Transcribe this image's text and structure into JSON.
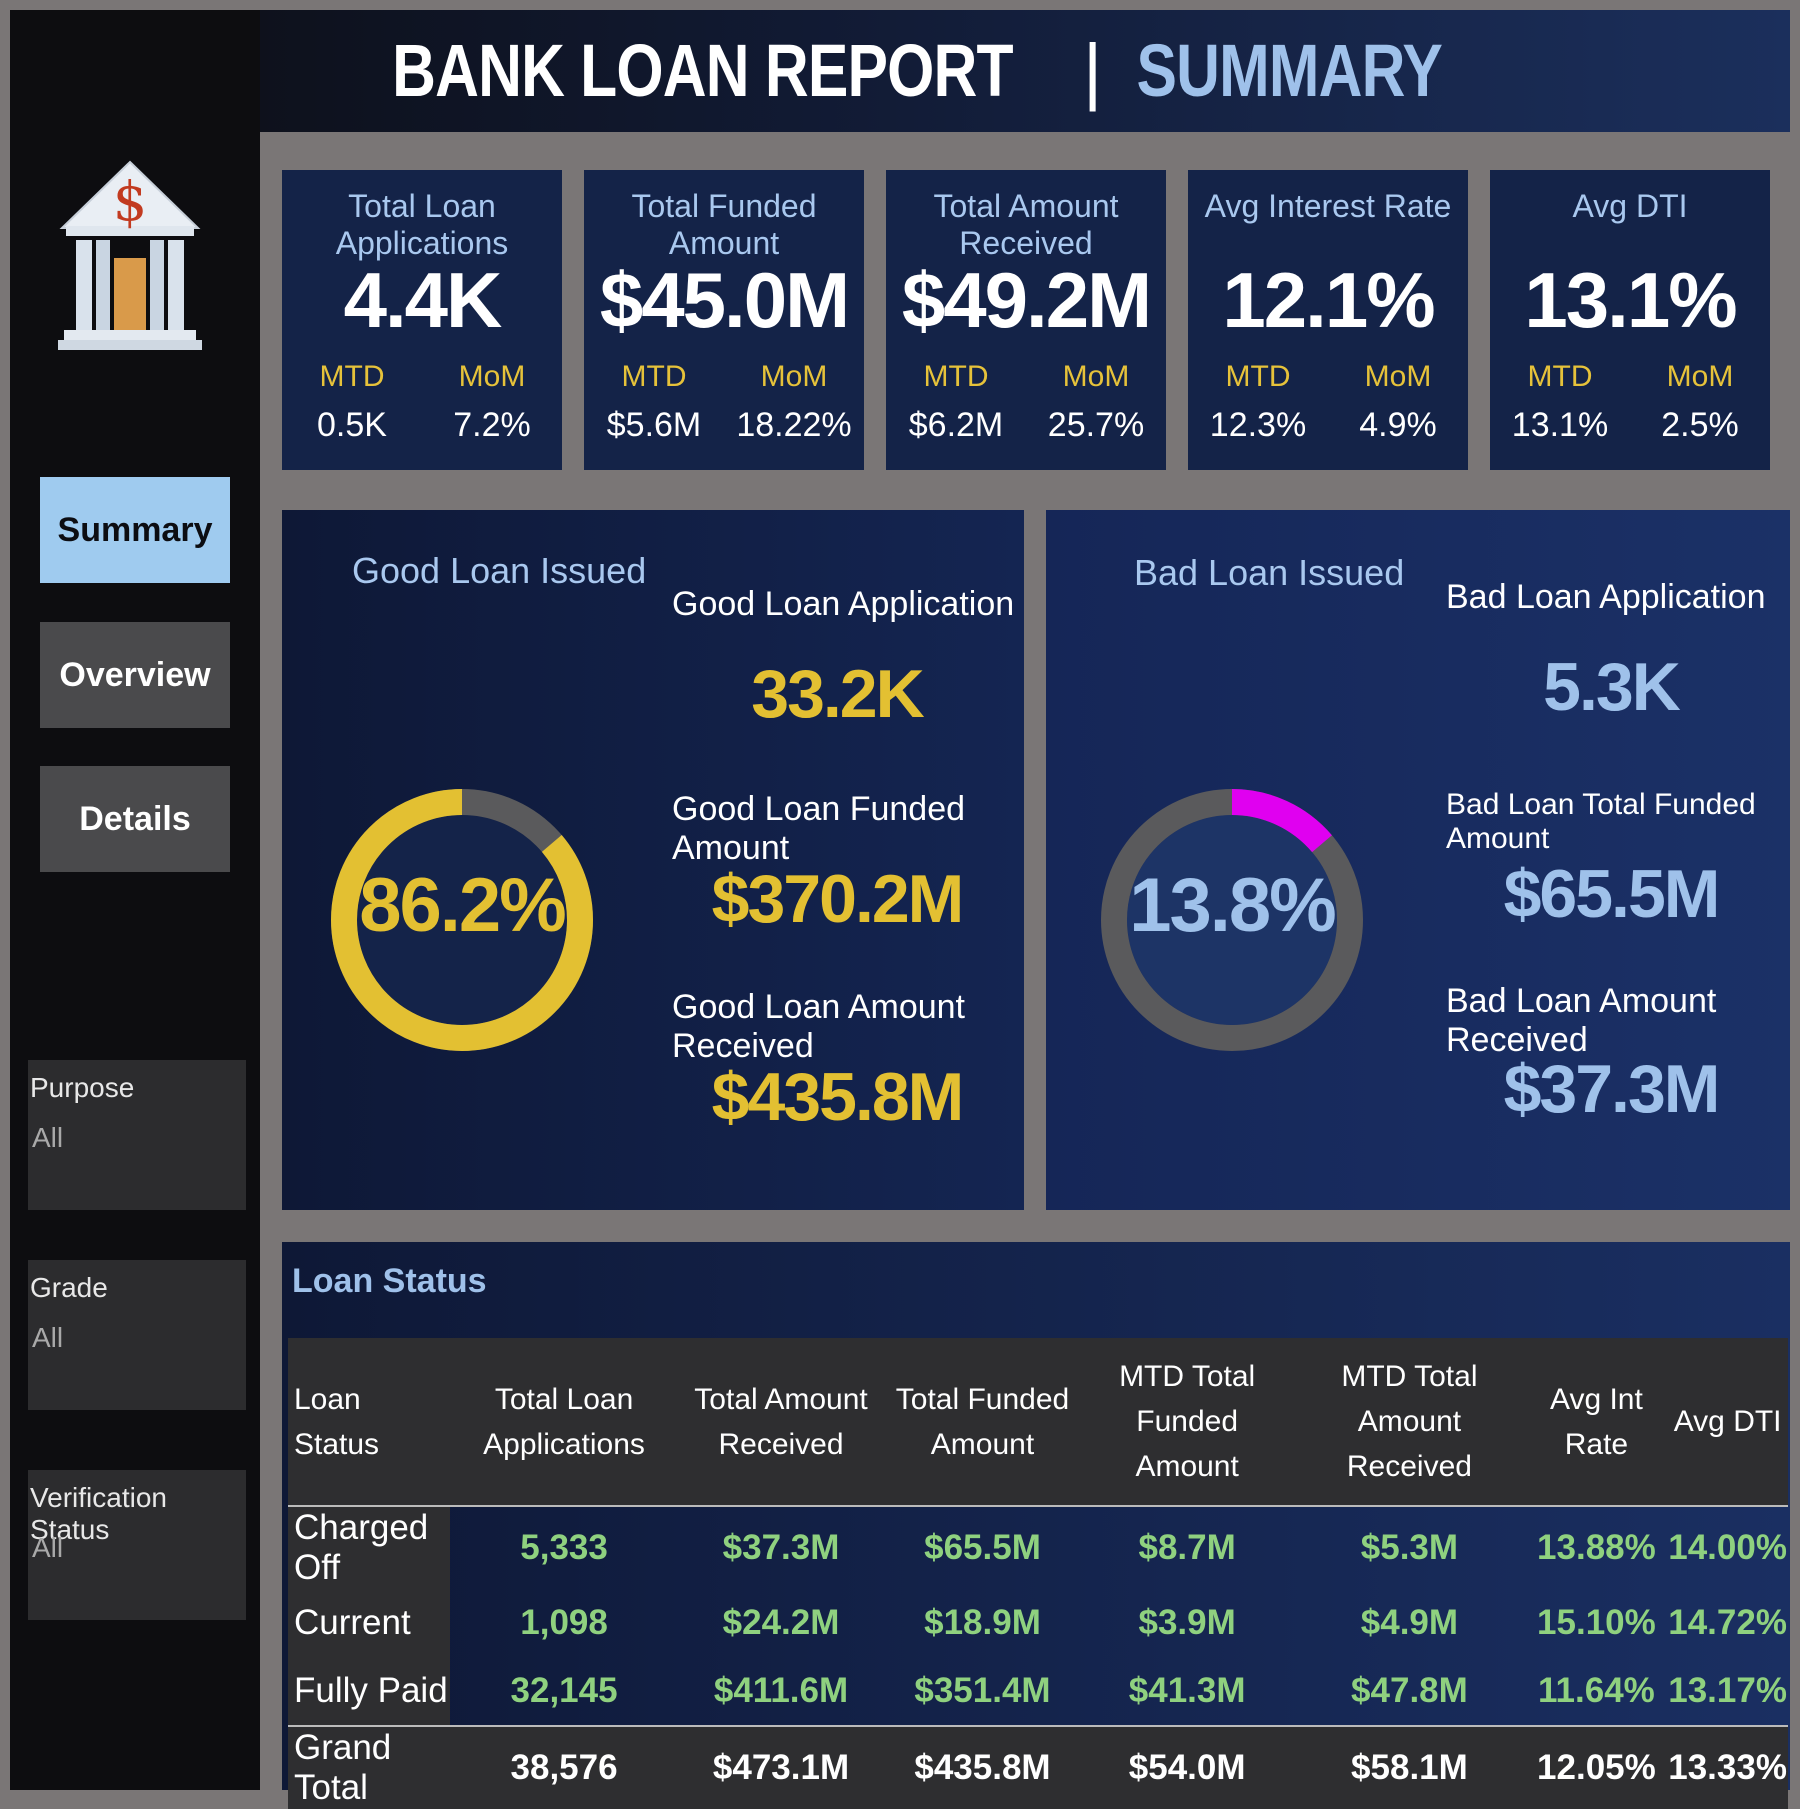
{
  "header": {
    "title_main": "BANK LOAN REPORT",
    "separator": "|",
    "title_sub": "SUMMARY"
  },
  "sidebar": {
    "nav": [
      {
        "label": "Summary",
        "active": true
      },
      {
        "label": "Overview",
        "active": false
      },
      {
        "label": "Details",
        "active": false
      }
    ],
    "filters": [
      {
        "label": "Purpose",
        "value": "All"
      },
      {
        "label": "Grade",
        "value": "All"
      },
      {
        "label": "Verification Status",
        "value": "All"
      }
    ],
    "logo_icon": "bank-dollar-icon"
  },
  "kpis": [
    {
      "label": "Total Loan Applications",
      "value": "4.4K",
      "mtd_label": "MTD",
      "mtd": "0.5K",
      "mom_label": "MoM",
      "mom": "7.2%"
    },
    {
      "label": "Total Funded Amount",
      "value": "$45.0M",
      "mtd_label": "MTD",
      "mtd": "$5.6M",
      "mom_label": "MoM",
      "mom": "18.22%"
    },
    {
      "label": "Total Amount Received",
      "value": "$49.2M",
      "mtd_label": "MTD",
      "mtd": "$6.2M",
      "mom_label": "MoM",
      "mom": "25.7%"
    },
    {
      "label": "Avg Interest Rate",
      "value": "12.1%",
      "mtd_label": "MTD",
      "mtd": "12.3%",
      "mom_label": "MoM",
      "mom": "4.9%"
    },
    {
      "label": "Avg DTI",
      "value": "13.1%",
      "mtd_label": "MTD",
      "mtd": "13.1%",
      "mom_label": "MoM",
      "mom": "2.5%"
    }
  ],
  "good_loan": {
    "title": "Good Loan Issued",
    "percent_label": "86.2%",
    "percent": 0.862,
    "app_label": "Good Loan Application",
    "app_value": "33.2K",
    "funded_label": "Good Loan Funded Amount",
    "funded_value": "$370.2M",
    "received_label": "Good Loan Amount Received",
    "received_value": "$435.8M",
    "colors": {
      "arc": "#e3c032",
      "track": "#5a5a5c"
    }
  },
  "bad_loan": {
    "title": "Bad Loan Issued",
    "percent_label": "13.8%",
    "percent": 0.138,
    "app_label": "Bad Loan Application",
    "app_value": "5.3K",
    "funded_label": "Bad Loan Total Funded Amount",
    "funded_value": "$65.5M",
    "received_label": "Bad Loan Amount Received",
    "received_value": "$37.3M",
    "colors": {
      "arc": "#e000f0",
      "track": "#5a5a5c"
    }
  },
  "loan_status_table": {
    "title": "Loan Status",
    "columns": [
      "Loan Status",
      "Total Loan Applications",
      "Total Amount Received",
      "Total Funded Amount",
      "MTD Total Funded Amount",
      "MTD Total Amount Received",
      "Avg Int Rate",
      "Avg DTI"
    ],
    "rows": [
      [
        "Charged Off",
        "5,333",
        "$37.3M",
        "$65.5M",
        "$8.7M",
        "$5.3M",
        "13.88%",
        "14.00%"
      ],
      [
        "Current",
        "1,098",
        "$24.2M",
        "$18.9M",
        "$3.9M",
        "$4.9M",
        "15.10%",
        "14.72%"
      ],
      [
        "Fully Paid",
        "32,145",
        "$411.6M",
        "$351.4M",
        "$41.3M",
        "$47.8M",
        "11.64%",
        "13.17%"
      ]
    ],
    "total": [
      "Grand Total",
      "38,576",
      "$473.1M",
      "$435.8M",
      "$54.0M",
      "$58.1M",
      "12.05%",
      "13.33%"
    ]
  },
  "colors": {
    "accent_gold": "#e3c032",
    "accent_blue": "#9fc1ea",
    "table_green": "#8fd17f"
  }
}
